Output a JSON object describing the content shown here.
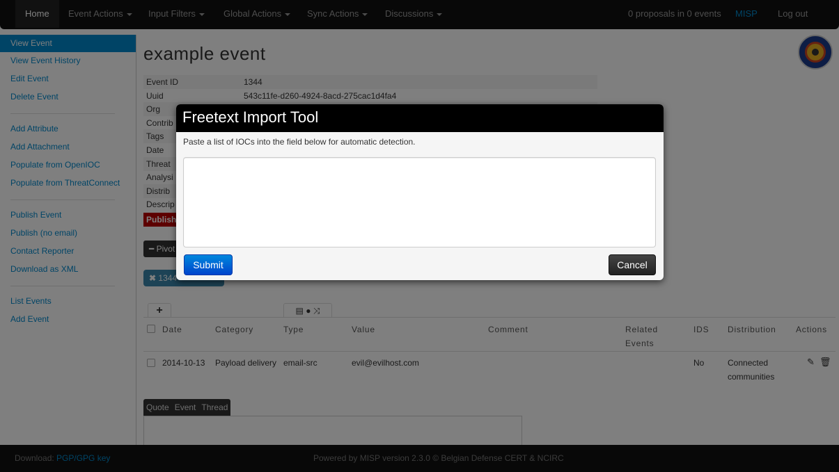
{
  "navbar": {
    "home": "Home",
    "menus": [
      "Event Actions",
      "Input Filters",
      "Global Actions",
      "Sync Actions",
      "Discussions"
    ],
    "proposals": "0 proposals in 0 events",
    "misp": "MISP",
    "logout": "Log out"
  },
  "sidebar": {
    "items": [
      "View Event",
      "View Event History",
      "Edit Event",
      "Delete Event",
      "Add Attribute",
      "Add Attachment",
      "Populate from OpenIOC",
      "Populate from ThreatConnect",
      "Publish Event",
      "Publish (no email)",
      "Contact Reporter",
      "Download as XML",
      "List Events",
      "Add Event"
    ]
  },
  "event": {
    "title": "example event",
    "fields": [
      {
        "key": "Event ID",
        "value": "1344"
      },
      {
        "key": "Uuid",
        "value": "543c11fe-d260-4924-8acd-275cac1d4fa4"
      },
      {
        "key": "Org",
        "value": ""
      },
      {
        "key": "Contrib",
        "value": ""
      },
      {
        "key": "Tags",
        "value": ""
      },
      {
        "key": "Date",
        "value": ""
      },
      {
        "key": "Threat",
        "value": ""
      },
      {
        "key": "Analysi",
        "value": ""
      },
      {
        "key": "Distrib",
        "value": ""
      },
      {
        "key": "Descrip",
        "value": ""
      }
    ],
    "published_label": "Publish",
    "pivot_label": "Pivot",
    "pivot_tag": "1344"
  },
  "table": {
    "headers": [
      "Date",
      "Category",
      "Type",
      "Value",
      "Comment",
      "Related Events",
      "IDS",
      "Distribution",
      "Actions"
    ],
    "rows": [
      {
        "date": "2014-10-13",
        "category": "Payload delivery",
        "type": "email-src",
        "value": "evil@evilhost.com",
        "comment": "",
        "related": "",
        "ids": "No",
        "distribution": "Connected communities"
      }
    ]
  },
  "discussion_tabs": [
    "Quote",
    "Event",
    "Thread"
  ],
  "footer": {
    "download_prefix": "Download:",
    "download_link": "PGP/GPG key",
    "powered": "Powered by MISP version 2.3.0 © Belgian Defense CERT & NCIRC"
  },
  "modal": {
    "title": "Freetext Import Tool",
    "message": "Paste a list of IOCs into the field below for automatic detection.",
    "textarea_value": "",
    "submit": "Submit",
    "cancel": "Cancel"
  }
}
